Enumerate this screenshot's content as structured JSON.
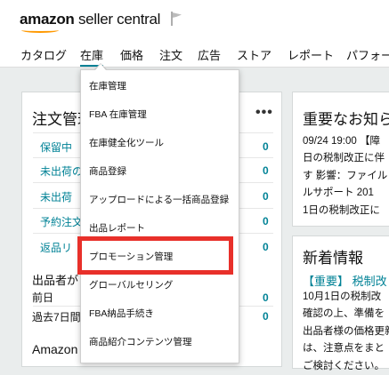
{
  "header": {
    "logo_brand": "amazon",
    "logo_product": "seller central",
    "flag_icon": "flag-icon"
  },
  "nav": {
    "items": [
      "カタログ",
      "在庫",
      "価格",
      "注文",
      "広告",
      "ストア",
      "レポート",
      "パフォー"
    ]
  },
  "orders": {
    "title": "注文管理",
    "more": "•••",
    "rows": [
      {
        "label": "保留中",
        "count": "0"
      },
      {
        "label": "未出荷の",
        "count": "0"
      },
      {
        "label": "未出荷",
        "count": "0"
      },
      {
        "label": "予約注文",
        "count": "0"
      },
      {
        "label": "返品リ",
        "count": "0"
      }
    ],
    "seller_section": "出品者が",
    "period_rows": [
      {
        "label": "前日",
        "count": "0"
      },
      {
        "label": "過去7日間",
        "count": "0"
      }
    ],
    "amazon_section": "Amazon"
  },
  "notices": {
    "title": "重要なお知ら",
    "lines": [
      "09/24 19:00 【障",
      "日の税制改正に伴",
      "す 影響：ファイル",
      "ルサポート 201",
      "1日の税制改正に"
    ]
  },
  "news": {
    "title": "新着情報",
    "link": "【重要】 税制改",
    "lines": [
      "10月1日の税制改",
      "確認の上、準備を",
      "出品者様の価格更新",
      "は、注意点をまと",
      "ご検討ください。"
    ]
  },
  "inventory_menu": {
    "items": [
      "在庫管理",
      "FBA 在庫管理",
      "在庫健全化ツール",
      "商品登録",
      "アップロードによる一括商品登録",
      "出品レポート",
      "プロモーション管理",
      "グローバルセリング",
      "FBA納品手続き",
      "商品紹介コンテンツ管理"
    ],
    "highlighted_index": 6,
    "highlight_color": "#e8302a"
  },
  "colors": {
    "link": "#008296",
    "accent": "#ff9900",
    "background": "#eaeded"
  }
}
